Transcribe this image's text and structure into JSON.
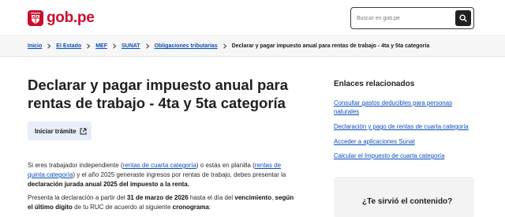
{
  "header": {
    "logo_text": "gob.pe",
    "search": {
      "placeholder": "Buscar en gob.pe"
    }
  },
  "breadcrumb": {
    "items": [
      "Inicio",
      "El Estado",
      "MEF",
      "SUNAT",
      "Obligaciones tributarias"
    ],
    "current": "Declarar y pagar impuesto anual para rentas de trabajo - 4ta y 5ta categoría"
  },
  "main": {
    "title": "Declarar y pagar impuesto anual para rentas de trabajo - 4ta y 5ta categoría",
    "cta_label": "Iniciar trámite",
    "p1": {
      "t1": "Si eres trabajador independiente (",
      "link1": "rentas de cuarta categoría",
      "t2": ") o estás en planilla (",
      "link2": "rentas de quinta categoría",
      "t3": ") y el año 2025 generaste ingresos por rentas de trabajo, debes presentar la ",
      "bold": "declaración jurada anual 2025 del impuesto a la renta."
    },
    "p2": {
      "t1": "Presenta la declaración a partir del ",
      "b1": "31 de marzo de 2026",
      "t2": " hasta el día del ",
      "b2": "vencimiento",
      "t3": ", ",
      "b3": "según el último dígito",
      "t4": " de tu RUC de acuerdo al siguiente ",
      "b4": "cronograma",
      "t5": ":"
    }
  },
  "aside": {
    "title": "Enlaces relacionados",
    "links": [
      "Consultar gastos deducibles para personas naturales",
      "Declaración y pago de rentas de cuarta categoría",
      "Acceder a aplicaciones Sunat",
      "Calcular el Impuesto de cuarta categoría"
    ]
  },
  "feedback": {
    "question": "¿Te sirvió el contenido?"
  },
  "colors": {
    "brand": "#c8102e",
    "link": "#0b4dbf",
    "cta_bg": "#e6eef7"
  },
  "icons": [
    "peru-coat-of-arms-icon",
    "search-icon",
    "chevron-right-icon",
    "external-link-icon"
  ]
}
